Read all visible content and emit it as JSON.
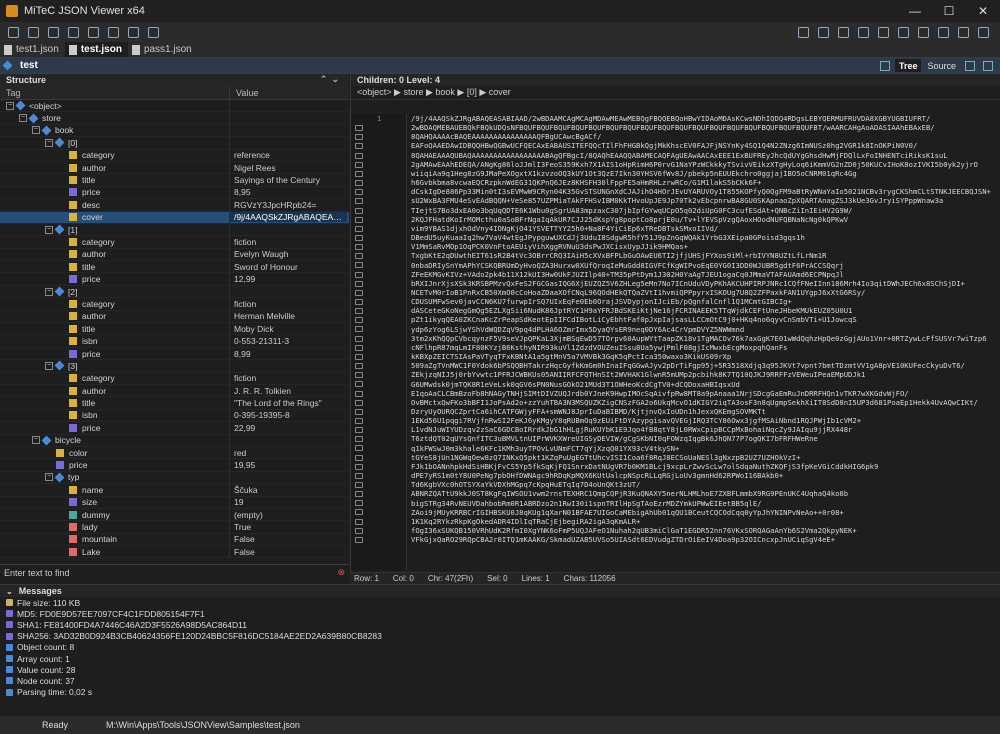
{
  "window": {
    "title": "MiTeC JSON Viewer x64",
    "minimize": "—",
    "maximize": "☐",
    "close": "✕"
  },
  "tabs": [
    {
      "label": "test1.json"
    },
    {
      "label": "test.json"
    },
    {
      "label": "pass1.json"
    }
  ],
  "document": {
    "name": "test",
    "view_tree": "Tree",
    "view_source": "Source"
  },
  "structure": {
    "title": "Structure",
    "col_tag": "Tag",
    "col_value": "Value",
    "find_placeholder": "Enter text to find",
    "rows": [
      {
        "indent": 0,
        "toggle": "−",
        "type": "obj",
        "tag": "<object>",
        "value": ""
      },
      {
        "indent": 1,
        "toggle": "−",
        "type": "obj",
        "tag": "store",
        "value": ""
      },
      {
        "indent": 2,
        "toggle": "−",
        "type": "obj",
        "tag": "book",
        "value": ""
      },
      {
        "indent": 3,
        "toggle": "−",
        "type": "obj",
        "tag": "[0]",
        "value": ""
      },
      {
        "indent": 4,
        "toggle": "",
        "type": "str",
        "tag": "category",
        "value": "reference"
      },
      {
        "indent": 4,
        "toggle": "",
        "type": "str",
        "tag": "author",
        "value": "Nigel Rees"
      },
      {
        "indent": 4,
        "toggle": "",
        "type": "str",
        "tag": "title",
        "value": "Sayings of the Century"
      },
      {
        "indent": 4,
        "toggle": "",
        "type": "num",
        "tag": "price",
        "value": "8,95"
      },
      {
        "indent": 4,
        "toggle": "",
        "type": "str",
        "tag": "desc",
        "value": "RGVzY3JpcHRpb24="
      },
      {
        "indent": 4,
        "toggle": "",
        "type": "str",
        "tag": "cover",
        "value": "/9j/4AAQSkZJRgABAQEASABIAA...",
        "selected": true
      },
      {
        "indent": 3,
        "toggle": "−",
        "type": "obj",
        "tag": "[1]",
        "value": ""
      },
      {
        "indent": 4,
        "toggle": "",
        "type": "str",
        "tag": "category",
        "value": "fiction"
      },
      {
        "indent": 4,
        "toggle": "",
        "type": "str",
        "tag": "author",
        "value": "Evelyn Waugh"
      },
      {
        "indent": 4,
        "toggle": "",
        "type": "str",
        "tag": "title",
        "value": "Sword of Honour"
      },
      {
        "indent": 4,
        "toggle": "",
        "type": "num",
        "tag": "price",
        "value": "12,99"
      },
      {
        "indent": 3,
        "toggle": "−",
        "type": "obj",
        "tag": "[2]",
        "value": ""
      },
      {
        "indent": 4,
        "toggle": "",
        "type": "str",
        "tag": "category",
        "value": "fiction"
      },
      {
        "indent": 4,
        "toggle": "",
        "type": "str",
        "tag": "author",
        "value": "Herman Melville"
      },
      {
        "indent": 4,
        "toggle": "",
        "type": "str",
        "tag": "title",
        "value": "Moby Dick"
      },
      {
        "indent": 4,
        "toggle": "",
        "type": "str",
        "tag": "isbn",
        "value": "0-553-21311-3"
      },
      {
        "indent": 4,
        "toggle": "",
        "type": "num",
        "tag": "price",
        "value": "8,99"
      },
      {
        "indent": 3,
        "toggle": "−",
        "type": "obj",
        "tag": "[3]",
        "value": ""
      },
      {
        "indent": 4,
        "toggle": "",
        "type": "str",
        "tag": "category",
        "value": "fiction"
      },
      {
        "indent": 4,
        "toggle": "",
        "type": "str",
        "tag": "author",
        "value": "J. R. R. Tolkien"
      },
      {
        "indent": 4,
        "toggle": "",
        "type": "str",
        "tag": "title",
        "value": "\"The Lord of the Rings\""
      },
      {
        "indent": 4,
        "toggle": "",
        "type": "str",
        "tag": "isbn",
        "value": "0-395-19395-8"
      },
      {
        "indent": 4,
        "toggle": "",
        "type": "num",
        "tag": "price",
        "value": "22,99"
      },
      {
        "indent": 2,
        "toggle": "−",
        "type": "obj",
        "tag": "bicycle",
        "value": ""
      },
      {
        "indent": 3,
        "toggle": "",
        "type": "str",
        "tag": "color",
        "value": "red"
      },
      {
        "indent": 3,
        "toggle": "",
        "type": "num",
        "tag": "price",
        "value": "19,95"
      },
      {
        "indent": 3,
        "toggle": "−",
        "type": "obj",
        "tag": "typ",
        "value": ""
      },
      {
        "indent": 4,
        "toggle": "",
        "type": "str",
        "tag": "name",
        "value": "Ščuka"
      },
      {
        "indent": 4,
        "toggle": "",
        "type": "num",
        "tag": "size",
        "value": "19"
      },
      {
        "indent": 4,
        "toggle": "",
        "type": "nul",
        "tag": "dummy",
        "value": "(empty)"
      },
      {
        "indent": 4,
        "toggle": "",
        "type": "bool",
        "tag": "lady",
        "value": "True"
      },
      {
        "indent": 4,
        "toggle": "",
        "type": "bool",
        "tag": "mountain",
        "value": "False"
      },
      {
        "indent": 4,
        "toggle": "",
        "type": "bool",
        "tag": "Lake",
        "value": "False"
      }
    ]
  },
  "content": {
    "header": "Children: 0   Level: 4",
    "breadcrumb": "<object> ▶ store ▶ book ▶ [0] ▶ cover",
    "line_number": "1",
    "lines": [
      "/9j/4AAQSkZJRgABAQEASABIAAD/2wBDAAMCAgMCAgMDAwMEAwMEBQgFBQQEBQoHBwYIDAoMDAsKCwsNDhIQDQ4RDgsLEBYQERMUFRUVDA8XGBYUGBIUFRT/",
      "2wBDAQMEBAUEBQkFBQkUDQsNFBQUFBQUFBQUFBQUFBQUFBQUFBQUFBQUFBQUFBQUFBQUFBQUFBQUFBQUFBQUFBQUFBQUFBT/wAARCAHgAoADASIAAhEBAxEB/",
      "8QAHQAAAAcBAQEAAAAAAAAAAAAAAAQFBgUCAwcBgACf/",
      "EAFoQAAEDAwIDBQQHBwQGBwUCFQECAxEABAUSITEFQQcTIlFhFHGBkQgjMkKhscEV0FAJFjNSYnKy4SQ1Q4N2ZNzg6ImNUSz0hg2VGR1k8InOKPiN0V0/",
      "8QAHAEAAAQUBAQAAAAAAAAAAAAAAAAABAgQFBgcI/8QAQhEAAQQABAMECAQFAgUEAwAACAxEEE1ExBUFREyJhcQdUYgGhsdHwMjFDQlLxFoINHENTciRiksK1suL",
      "2gAMAwEAAhEDEQA/ANgKg86loJJmlI3FeoS359Kxh7X1AIS1oHpRimH6P0rvG1NaYPzWCkkkyTSvivVEikzXTgHyLoq6iKmmVG2nZD0j50KUCvIHoK8ozIVKI5b0yk2yjrO",
      "wiiqiAa9q1Heg8zG9JMaPeXOgxtX1kzvzoOQ3kUY1Ot3QzE7Ikn30YHSV6fWv8J/pbekp5nEUUEkchro0ggjajIBO5oCNRM01qRc4Gg",
      "h6Gvbkbma8vcwaEQCRzpknWdEG31QKPnQ6JEz8KHSFH30lFppFE5aHmRHLzrwRCo/G1M1lakS5bCKk6F+",
      "dCskIgDe886Pp33Min0tI3sEVMwW9CRyn04K35GvSTSUNGnXdCJAJihO4HOrJEvUYARUVOy1T855KOPfyQ0QgFM9aBtRyWNaYaIo5021NCBv3rygCKShmCLtSTNKJEECBQJSN+",
      "sU2WxBA3FMU4eSvEAdBQQN+VeSe857UZPMiaTAkFFHSvIBM0KkTHvoUpJE9Jp70Tk2vEbcpnrwBA8GU0SKApnaoZpXQARTAnagZSJ3kUe3GvJryiSYPppWnaw3a",
      "TIejtS7Bo3dxEA0o3bqUqQDTE6K1Wbu0gSgrUA83mpzaxC307jbIpfGYwqUCpO5q02diUpG0FC3cufESdAt+QNBcZiInIEiHV2G9W/",
      "2KQJFHatdKoIrMOMcthu0aSoBFrNgaIqAkUR7CJJ25dKspYg8poptCo8prjE0u/Tv+lYEVSpVzgQAoxHOodNUFQBNaNcNg0kQPKwV",
      "vim9YBAS1djxhOdVny4IONgKjO41YSVETTYY25h0+Na8F4YiCiEp6xTReDBTskSMxoIIVd/",
      "DBedU5uyKuaaIq2hw7VaV4wtEgJPypguwUXCdJj3UduI8SdgwR5hfY51J9pZnGqWQAk1YrbG3XEipa0GPoisd3gqs1h",
      "V1MmSaRvMOp1OqPCK0VnFtoAEUiyVihXggRVNuU3dsPwJXCisxUypJJik9HMQas+",
      "TxgbKtE2qDUwthEIT61sR2B4tVc3OBrrCRQ3IAiH5cXVxBFPLbGuOAwEU6TI2jfjUHSjFYXos9iMl+rbIVYN8UZtLfLrNm1R",
      "0nbaDRIySnYmAPhYCSKQBRUmDyHvoQZA3Hurxw0XUfQroqIeMuGdd8IGVFCfKgWIPvoEqE0YG0I3DD0WJUBR5gdtF6PrACCSQqrj",
      "ZFeEKMGvKIVz+VAdo2pk4b11X12kUI3Hw0UkFJUZIlp40+TM35pPtDym1J302H0YaAgTJEU1ogaCq0JMmaVTAFAUAmd6ECPNpqJl",
      "bRXIJnrXjsXSk3KRSBPMzvQxFeS2FGCGasIQG6XjEUZQZ5V6ZHLeg5eMn7No7ICnUduVDyPKhAKCUHPIRPJNRc1CQfFNeIInn186Mrh4Io3qitDWhJECh6x8SChSjDI+",
      "NCETvM0rIoB1PnRxCB50XmO0cCoHoaZDaaXOfCNqL96QOdHEkQTQaZVtI1hvmiQPPpyrxISKOUg7U8Q2ZFPaxkFAN1UYgpJ6xXtG6RSy/",
      "CDUSUMFwSev0javCCN6KU7furwpIrSQ7UIxEqFe0Eb0OrajJSVDypjonIJciEb/pQgnfalCnfl1Q1MCmtGIBCIg+",
      "dASCeteGKoNegGmQg5EZLXgSii6NudK86JptRYC1H9aYFRJBdSKEiKtjNe16jFCRINAEEK5TTqWjdkCEFtUneJHbeKMUkEUZ05U0U1",
      "pZt1ikyqQEA0ZKCnaKcZrPeapSdKeotEpIIFCdIBotLiCyEbhtFaf0pJxpIajsasLLCCmOtC9j0+HKq4no6qyvCnSmbVTi+U1JowcqS",
      "ydp6zYog6LSjwYShVdWQDZqV9pq4dPLHA6OZmrImx5DyaQYsER9neq0DY6Ac4CrVpmDVYZ5NWWmnd",
      "3tm2xKhQQpCVbcqynzF5V9seVJpQPKaL3XjmBSqEwD57TOrpv60AupWYtTaapZK18v1TgMACOv76k7axGgK7E01wWdQqhzHpQe0zGgjAUo1Vnr+0RTZywLcFfSUSVr7wiTzp6",
      "cNFlhpR87mqLmIF80KYzjB6KsthyNIR93kuVl1ZdzdVOUZeuISsu8Ua5ywjPmlF08gjIcMwxbEcgMoxpqhQanFs",
      "kKBXpZEICTSIAsPaVTyqTFxKBNtA1a5gtMnV5a7VMVBk3GqK5qPctIca350waxo3KikUS09rXp",
      "509aZgTVnMWC1F0Ydok6bPSQQBHTakrzHqcGyfkKmGm0hInaIFqGGwAJyv2pDrTiFgp95j+5R3518Xdjq3q95JKVt7vpnt7bmtTDzmtVV1gA8pVE10KUFecCkyuDvT6/",
      "ZEkjzqNIJ5j0rbYvwtc1PFRJCWBKUs05ANIIRFCFQTHnSIt2WVHAK1GlwnR5mUMp2pcbihk8K7TQ10QJKJ9RRFFzVEWeuIPeaEMpUDJk1",
      "G6UMwdsk0jmTQK8R1eVeLsk0qGV6sPN0NusGOkO21MUd3T1OWHeoKcdCgTV0+dCQDoxaHBIqsxUd",
      "E1qoAaCLCBmBzoFb8hNAGyTNHjSIMtDIVZUQJrdb0YJneK9HwpIMOcSqAivfpRw8MT8a9pAnaaa1NrjSDcgGaEmRuJnDRRFHQn1vTKR7wXKGdvWjFO/",
      "OvBMctxQwFKo3bBFI1JoPsAd2o+zzYuhTBA3N3MSQUZKZigCNSzFGA2o6UkqMcvO1dKIGY2iqTA3osF3n8qUgmpSekhXiIT8SdD8nI5UP3d681PoaEp1Hekk4UvAQwCIKt/",
      "DzryUyOURQCZprtCa6ihCATFGWjyFFA+smWNJ8JprIuDaBIBMD/KjtjnvQxIoUDn1hJexxQKEmgSOVMKTt",
      "1EKd56U1pqgi7RVjfnRwSI2FeKJ6yKMgyY8qRUBmOq9zEUiFtDYAzypgisavQVEGjIRQ3TCY86Owx3jgfMSAiNbnd1RQJPWjIb1cVM2+",
      "L1vdNJuWIYUDzqv2zSaC6GDCBoIRrdkJbG1hHLgjRuKUYbK1E9Jqo4fB8qtY8jL0RWxCpipBCCpMxBohaiNqcZy9JAIqu9jjRX448r",
      "T6ztdQT02qUYsQnfITC3uBMVLtnUIPrWVKXWreUIGSyDEVIW/gCgSKbNI0qFOWzqIqgBk6JhQN77P7ogQKI7bFRFHWeRne",
      "q1kFWSwJ0m3khale6KFc1KMh3uyTPOvLvUNmFCT7qYjXzqQ01YX93cV4tkySN+",
      "tGYeS8jUn1NGWqOew8zQ7INKxQ5pkt1KZqPuUgEGTtUhcvISI1Coa6f8RqJ8ECSoUaNESl3gNxzpB2UZ7UZHOkVzI+",
      "FJk1bOANnhpkHdSiHBKjFvCS5Yp5fkSqKjFQ1SnrxDatNUgVR7b0KM1BLcj9xcpLrZwvScLw7olSdqaNuthZKQFjS3fpKeVGiCddkHIG6pk9",
      "dPE7yRS1m0tY8U0PeNg7pbOHfDWNAgc9hRDqKpMQX6KUtUalcpNSpcRLLqRGjLoUv3gmnHd62RPWoI16BAkb0+",
      "Td6KgbVXc0hOTSYXaYkVDXhMGpq7cKpqHuETqIq7D4oUnQKt3zUT/",
      "ABNRZQATtU9kkJ0ST8KgFqIWSOU1vwm2rnsTEXHRC1QmgCQPjR3KuQNAXY5nerNLHMLhoE7ZXBFLmmbX9RG9PEnUKC4UqhaQ4ko8b",
      "bigSTRg34RvNEUVDahbobRm0R1ABRDzo2n1RwI30i1spnTRIlHpSgTAoEzrMDZYmkUPWwEIEetBB5qlE/",
      "ZAoi9jMUyKRRBCrIGIHBSKU0J8qKUg1qXarN01BFAE7UIGoCaMEbigAhUb01qQU1BCeutCQCOdCqq0yYpJhYNINPvNeAo++0r08+",
      "1K1Kq2RYkzRkpKgOkedADR4IDlIqTRaCjEjbegiRA2igA3qKmALR+",
      "fOgI36xSUKQB150VRhUdK2RfmI0XgYNK6oFmP5UQJAFeO1Nuhah2qUB3miClGaT1EGDR52nn76VKxSORQAGaAnYb6S2Vma2QkpyNEK+",
      "VFkGjxQaRO29RQpCBA2r0ITQ1mKAAKG/SkmadUZAB5UVSo5UIASdt6EDVudgZTDrOiEeIV4Doa9p32OICncxpJnUCiqSgV4eE+"
    ]
  },
  "statusline": {
    "row": "Row: 1",
    "col": "Col: 0",
    "chr": "Chr: 47(2Fh)",
    "sel": "Sel: 0",
    "lines": "Lines: 1",
    "chars": "Chars: 112056"
  },
  "messages": {
    "title": "Messages",
    "items": [
      {
        "icon": "f",
        "text": "File size: 110 KB"
      },
      {
        "icon": "t",
        "text": "MD5: FD0E9D57EE7097CF4C1FDD805154F7F1"
      },
      {
        "icon": "t",
        "text": "SHA1: FE81400FD4A7446C46A2D3F5526A98D5AC864D11"
      },
      {
        "icon": "t",
        "text": "SHA256: 3AD32B0D924B3CB40624356FE120D24BBC5F816DC5184AE2ED2A639B80CB8283"
      },
      {
        "icon": "o",
        "text": "Object count: 8"
      },
      {
        "icon": "o",
        "text": "Array count: 1"
      },
      {
        "icon": "o",
        "text": "Value count: 28"
      },
      {
        "icon": "o",
        "text": "Node count: 37"
      },
      {
        "icon": "o",
        "text": "Parsing time: 0,02 s"
      }
    ]
  },
  "status": {
    "state": "Ready",
    "path": "M:\\Win\\Apps\\Tools\\JSONView\\Samples\\test.json"
  }
}
